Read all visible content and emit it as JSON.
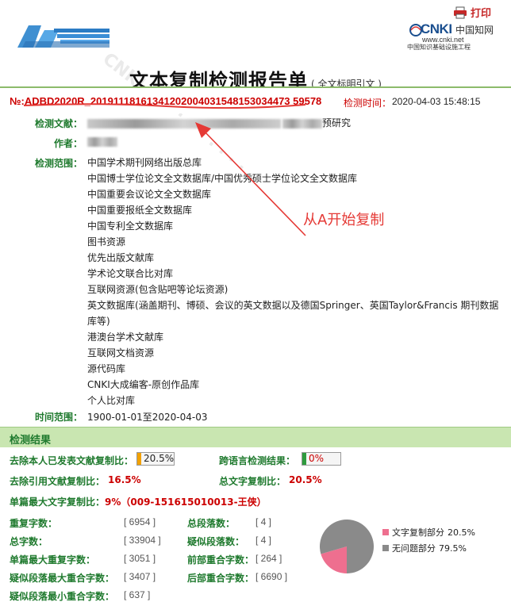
{
  "header": {
    "print_label": "打印",
    "cnki_word": "CNKI",
    "cnki_cn": "中国知网",
    "cnki_url": "www.cnki.net",
    "cnki_sub": "中国知识基础设施工程",
    "title": "文本复制检测报告单",
    "subtitle": "( 全文标明引文 )"
  },
  "report": {
    "number": "№:ADBD2020R_20191118161341202004031548153034473 59578",
    "detect_time_label": "检测时间：",
    "detect_time": "2020-04-03 15:48:15"
  },
  "info": {
    "doc_label": "检测文献：",
    "doc_value_tail": "预研究",
    "author_label": "作者：",
    "range_label": "检测范围：",
    "databases": [
      "中国学术期刊网络出版总库",
      "中国博士学位论文全文数据库/中国优秀硕士学位论文全文数据库",
      "中国重要会议论文全文数据库",
      "中国重要报纸全文数据库",
      "中国专利全文数据库",
      "图书资源",
      "优先出版文献库",
      "学术论文联合比对库",
      "互联网资源(包含贴吧等论坛资源)",
      "英文数据库(涵盖期刊、博硕、会议的英文数据以及德国Springer、英国Taylor&Francis 期刊数据库等)",
      "港澳台学术文献库",
      "互联网文档资源",
      "源代码库",
      "CNKI大成编客-原创作品库",
      "个人比对库"
    ],
    "time_label": "时间范围：",
    "time_value": "1900-01-01至2020-04-03"
  },
  "annotation": "从A开始复制",
  "results": {
    "section_title": "检测结果",
    "self_excl_label": "去除本人已发表文献复制比：",
    "self_excl_value": "20.5%",
    "cross_lang_label": "跨语言检测结果：",
    "cross_lang_value": "0%",
    "ref_excl_label": "去除引用文献复制比：",
    "ref_excl_value": "16.5%",
    "total_label": "总文字复制比：",
    "total_value": "20.5%",
    "max_single_label": "单篇最大文字复制比：",
    "max_single_value": "9%（009-151615010013-王侠）",
    "stats_left": [
      {
        "label": "重复字数：",
        "value": "[ 6954 ]"
      },
      {
        "label": "总字数：",
        "value": "[ 33904 ]"
      },
      {
        "label": "单篇最大重复字数：",
        "value": "[ 3051 ]"
      },
      {
        "label": "疑似段落最大重合字数：",
        "value": "[ 3407 ]"
      },
      {
        "label": "疑似段落最小重合字数：",
        "value": "[ 637 ]"
      }
    ],
    "stats_right": [
      {
        "label": "总段落数：",
        "value": "[ 4 ]"
      },
      {
        "label": "疑似段落数：",
        "value": "[ 4 ]"
      },
      {
        "label": "前部重合字数：",
        "value": "[ 264 ]"
      },
      {
        "label": "后部重合字数：",
        "value": "[ 6690 ]"
      }
    ]
  },
  "chart_data": {
    "type": "pie",
    "categories": [
      "文字复制部分",
      "无问题部分"
    ],
    "values": [
      20.5,
      79.5
    ],
    "labels": [
      "20.5%",
      "79.5%"
    ],
    "colors": [
      "#ee6f8f",
      "#8a8a8a"
    ],
    "legend_position": "right"
  },
  "colors": {
    "green_label": "#1f7a2e",
    "red": "#cc0000",
    "result_band": "#c9e6b1"
  }
}
